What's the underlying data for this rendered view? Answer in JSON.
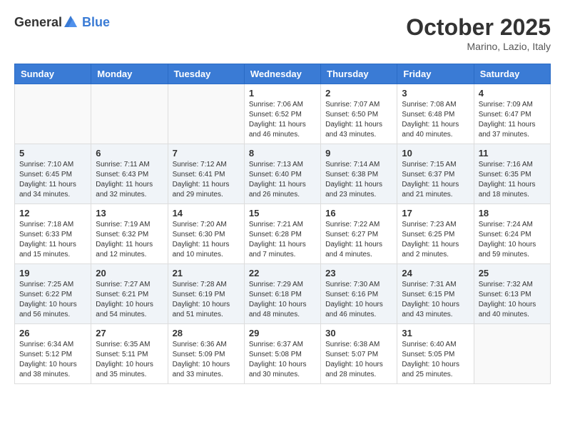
{
  "header": {
    "logo_general": "General",
    "logo_blue": "Blue",
    "month_title": "October 2025",
    "location": "Marino, Lazio, Italy"
  },
  "weekdays": [
    "Sunday",
    "Monday",
    "Tuesday",
    "Wednesday",
    "Thursday",
    "Friday",
    "Saturday"
  ],
  "weeks": [
    [
      {
        "day": "",
        "info": ""
      },
      {
        "day": "",
        "info": ""
      },
      {
        "day": "",
        "info": ""
      },
      {
        "day": "1",
        "info": "Sunrise: 7:06 AM\nSunset: 6:52 PM\nDaylight: 11 hours\nand 46 minutes."
      },
      {
        "day": "2",
        "info": "Sunrise: 7:07 AM\nSunset: 6:50 PM\nDaylight: 11 hours\nand 43 minutes."
      },
      {
        "day": "3",
        "info": "Sunrise: 7:08 AM\nSunset: 6:48 PM\nDaylight: 11 hours\nand 40 minutes."
      },
      {
        "day": "4",
        "info": "Sunrise: 7:09 AM\nSunset: 6:47 PM\nDaylight: 11 hours\nand 37 minutes."
      }
    ],
    [
      {
        "day": "5",
        "info": "Sunrise: 7:10 AM\nSunset: 6:45 PM\nDaylight: 11 hours\nand 34 minutes."
      },
      {
        "day": "6",
        "info": "Sunrise: 7:11 AM\nSunset: 6:43 PM\nDaylight: 11 hours\nand 32 minutes."
      },
      {
        "day": "7",
        "info": "Sunrise: 7:12 AM\nSunset: 6:41 PM\nDaylight: 11 hours\nand 29 minutes."
      },
      {
        "day": "8",
        "info": "Sunrise: 7:13 AM\nSunset: 6:40 PM\nDaylight: 11 hours\nand 26 minutes."
      },
      {
        "day": "9",
        "info": "Sunrise: 7:14 AM\nSunset: 6:38 PM\nDaylight: 11 hours\nand 23 minutes."
      },
      {
        "day": "10",
        "info": "Sunrise: 7:15 AM\nSunset: 6:37 PM\nDaylight: 11 hours\nand 21 minutes."
      },
      {
        "day": "11",
        "info": "Sunrise: 7:16 AM\nSunset: 6:35 PM\nDaylight: 11 hours\nand 18 minutes."
      }
    ],
    [
      {
        "day": "12",
        "info": "Sunrise: 7:18 AM\nSunset: 6:33 PM\nDaylight: 11 hours\nand 15 minutes."
      },
      {
        "day": "13",
        "info": "Sunrise: 7:19 AM\nSunset: 6:32 PM\nDaylight: 11 hours\nand 12 minutes."
      },
      {
        "day": "14",
        "info": "Sunrise: 7:20 AM\nSunset: 6:30 PM\nDaylight: 11 hours\nand 10 minutes."
      },
      {
        "day": "15",
        "info": "Sunrise: 7:21 AM\nSunset: 6:28 PM\nDaylight: 11 hours\nand 7 minutes."
      },
      {
        "day": "16",
        "info": "Sunrise: 7:22 AM\nSunset: 6:27 PM\nDaylight: 11 hours\nand 4 minutes."
      },
      {
        "day": "17",
        "info": "Sunrise: 7:23 AM\nSunset: 6:25 PM\nDaylight: 11 hours\nand 2 minutes."
      },
      {
        "day": "18",
        "info": "Sunrise: 7:24 AM\nSunset: 6:24 PM\nDaylight: 10 hours\nand 59 minutes."
      }
    ],
    [
      {
        "day": "19",
        "info": "Sunrise: 7:25 AM\nSunset: 6:22 PM\nDaylight: 10 hours\nand 56 minutes."
      },
      {
        "day": "20",
        "info": "Sunrise: 7:27 AM\nSunset: 6:21 PM\nDaylight: 10 hours\nand 54 minutes."
      },
      {
        "day": "21",
        "info": "Sunrise: 7:28 AM\nSunset: 6:19 PM\nDaylight: 10 hours\nand 51 minutes."
      },
      {
        "day": "22",
        "info": "Sunrise: 7:29 AM\nSunset: 6:18 PM\nDaylight: 10 hours\nand 48 minutes."
      },
      {
        "day": "23",
        "info": "Sunrise: 7:30 AM\nSunset: 6:16 PM\nDaylight: 10 hours\nand 46 minutes."
      },
      {
        "day": "24",
        "info": "Sunrise: 7:31 AM\nSunset: 6:15 PM\nDaylight: 10 hours\nand 43 minutes."
      },
      {
        "day": "25",
        "info": "Sunrise: 7:32 AM\nSunset: 6:13 PM\nDaylight: 10 hours\nand 40 minutes."
      }
    ],
    [
      {
        "day": "26",
        "info": "Sunrise: 6:34 AM\nSunset: 5:12 PM\nDaylight: 10 hours\nand 38 minutes."
      },
      {
        "day": "27",
        "info": "Sunrise: 6:35 AM\nSunset: 5:11 PM\nDaylight: 10 hours\nand 35 minutes."
      },
      {
        "day": "28",
        "info": "Sunrise: 6:36 AM\nSunset: 5:09 PM\nDaylight: 10 hours\nand 33 minutes."
      },
      {
        "day": "29",
        "info": "Sunrise: 6:37 AM\nSunset: 5:08 PM\nDaylight: 10 hours\nand 30 minutes."
      },
      {
        "day": "30",
        "info": "Sunrise: 6:38 AM\nSunset: 5:07 PM\nDaylight: 10 hours\nand 28 minutes."
      },
      {
        "day": "31",
        "info": "Sunrise: 6:40 AM\nSunset: 5:05 PM\nDaylight: 10 hours\nand 25 minutes."
      },
      {
        "day": "",
        "info": ""
      }
    ]
  ]
}
